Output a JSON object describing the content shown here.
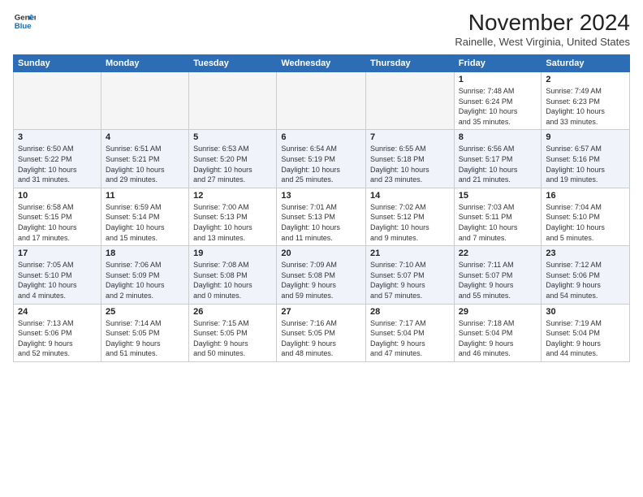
{
  "logo": {
    "line1": "General",
    "line2": "Blue"
  },
  "title": "November 2024",
  "location": "Rainelle, West Virginia, United States",
  "days_header": [
    "Sunday",
    "Monday",
    "Tuesday",
    "Wednesday",
    "Thursday",
    "Friday",
    "Saturday"
  ],
  "weeks": [
    [
      {
        "day": "",
        "info": ""
      },
      {
        "day": "",
        "info": ""
      },
      {
        "day": "",
        "info": ""
      },
      {
        "day": "",
        "info": ""
      },
      {
        "day": "",
        "info": ""
      },
      {
        "day": "1",
        "info": "Sunrise: 7:48 AM\nSunset: 6:24 PM\nDaylight: 10 hours\nand 35 minutes."
      },
      {
        "day": "2",
        "info": "Sunrise: 7:49 AM\nSunset: 6:23 PM\nDaylight: 10 hours\nand 33 minutes."
      }
    ],
    [
      {
        "day": "3",
        "info": "Sunrise: 6:50 AM\nSunset: 5:22 PM\nDaylight: 10 hours\nand 31 minutes."
      },
      {
        "day": "4",
        "info": "Sunrise: 6:51 AM\nSunset: 5:21 PM\nDaylight: 10 hours\nand 29 minutes."
      },
      {
        "day": "5",
        "info": "Sunrise: 6:53 AM\nSunset: 5:20 PM\nDaylight: 10 hours\nand 27 minutes."
      },
      {
        "day": "6",
        "info": "Sunrise: 6:54 AM\nSunset: 5:19 PM\nDaylight: 10 hours\nand 25 minutes."
      },
      {
        "day": "7",
        "info": "Sunrise: 6:55 AM\nSunset: 5:18 PM\nDaylight: 10 hours\nand 23 minutes."
      },
      {
        "day": "8",
        "info": "Sunrise: 6:56 AM\nSunset: 5:17 PM\nDaylight: 10 hours\nand 21 minutes."
      },
      {
        "day": "9",
        "info": "Sunrise: 6:57 AM\nSunset: 5:16 PM\nDaylight: 10 hours\nand 19 minutes."
      }
    ],
    [
      {
        "day": "10",
        "info": "Sunrise: 6:58 AM\nSunset: 5:15 PM\nDaylight: 10 hours\nand 17 minutes."
      },
      {
        "day": "11",
        "info": "Sunrise: 6:59 AM\nSunset: 5:14 PM\nDaylight: 10 hours\nand 15 minutes."
      },
      {
        "day": "12",
        "info": "Sunrise: 7:00 AM\nSunset: 5:13 PM\nDaylight: 10 hours\nand 13 minutes."
      },
      {
        "day": "13",
        "info": "Sunrise: 7:01 AM\nSunset: 5:13 PM\nDaylight: 10 hours\nand 11 minutes."
      },
      {
        "day": "14",
        "info": "Sunrise: 7:02 AM\nSunset: 5:12 PM\nDaylight: 10 hours\nand 9 minutes."
      },
      {
        "day": "15",
        "info": "Sunrise: 7:03 AM\nSunset: 5:11 PM\nDaylight: 10 hours\nand 7 minutes."
      },
      {
        "day": "16",
        "info": "Sunrise: 7:04 AM\nSunset: 5:10 PM\nDaylight: 10 hours\nand 5 minutes."
      }
    ],
    [
      {
        "day": "17",
        "info": "Sunrise: 7:05 AM\nSunset: 5:10 PM\nDaylight: 10 hours\nand 4 minutes."
      },
      {
        "day": "18",
        "info": "Sunrise: 7:06 AM\nSunset: 5:09 PM\nDaylight: 10 hours\nand 2 minutes."
      },
      {
        "day": "19",
        "info": "Sunrise: 7:08 AM\nSunset: 5:08 PM\nDaylight: 10 hours\nand 0 minutes."
      },
      {
        "day": "20",
        "info": "Sunrise: 7:09 AM\nSunset: 5:08 PM\nDaylight: 9 hours\nand 59 minutes."
      },
      {
        "day": "21",
        "info": "Sunrise: 7:10 AM\nSunset: 5:07 PM\nDaylight: 9 hours\nand 57 minutes."
      },
      {
        "day": "22",
        "info": "Sunrise: 7:11 AM\nSunset: 5:07 PM\nDaylight: 9 hours\nand 55 minutes."
      },
      {
        "day": "23",
        "info": "Sunrise: 7:12 AM\nSunset: 5:06 PM\nDaylight: 9 hours\nand 54 minutes."
      }
    ],
    [
      {
        "day": "24",
        "info": "Sunrise: 7:13 AM\nSunset: 5:06 PM\nDaylight: 9 hours\nand 52 minutes."
      },
      {
        "day": "25",
        "info": "Sunrise: 7:14 AM\nSunset: 5:05 PM\nDaylight: 9 hours\nand 51 minutes."
      },
      {
        "day": "26",
        "info": "Sunrise: 7:15 AM\nSunset: 5:05 PM\nDaylight: 9 hours\nand 50 minutes."
      },
      {
        "day": "27",
        "info": "Sunrise: 7:16 AM\nSunset: 5:05 PM\nDaylight: 9 hours\nand 48 minutes."
      },
      {
        "day": "28",
        "info": "Sunrise: 7:17 AM\nSunset: 5:04 PM\nDaylight: 9 hours\nand 47 minutes."
      },
      {
        "day": "29",
        "info": "Sunrise: 7:18 AM\nSunset: 5:04 PM\nDaylight: 9 hours\nand 46 minutes."
      },
      {
        "day": "30",
        "info": "Sunrise: 7:19 AM\nSunset: 5:04 PM\nDaylight: 9 hours\nand 44 minutes."
      }
    ]
  ]
}
